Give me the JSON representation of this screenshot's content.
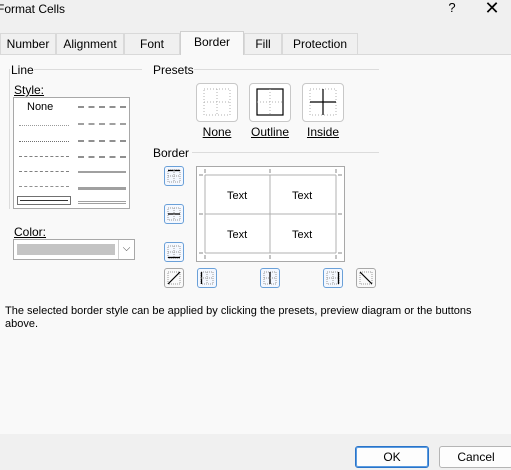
{
  "window": {
    "title": "Format Cells",
    "help_label": "?",
    "close_label": "✕"
  },
  "tabs": [
    {
      "label": "Number",
      "active": false
    },
    {
      "label": "Alignment",
      "active": false
    },
    {
      "label": "Font",
      "active": false
    },
    {
      "label": "Border",
      "active": true
    },
    {
      "label": "Fill",
      "active": false
    },
    {
      "label": "Protection",
      "active": false
    }
  ],
  "line_group": {
    "title": "Line",
    "style_label": "Style:",
    "style_none": "None",
    "color_label": "Color:",
    "color_value": "#c4c4c4"
  },
  "presets": {
    "title": "Presets",
    "items": [
      {
        "label": "None",
        "icon": "preset-none-icon"
      },
      {
        "label": "Outline",
        "icon": "preset-outline-icon"
      },
      {
        "label": "Inside",
        "icon": "preset-inside-icon"
      }
    ]
  },
  "border": {
    "title": "Border",
    "preview_cells": [
      "Text",
      "Text",
      "Text",
      "Text"
    ]
  },
  "description": "The selected border style can be applied by clicking the presets, preview diagram or the buttons above.",
  "footer": {
    "ok_label": "OK",
    "cancel_label": "Cancel"
  },
  "colors": {
    "accent_border": "#2a74c9",
    "button_highlight": "#6aa0d8"
  }
}
